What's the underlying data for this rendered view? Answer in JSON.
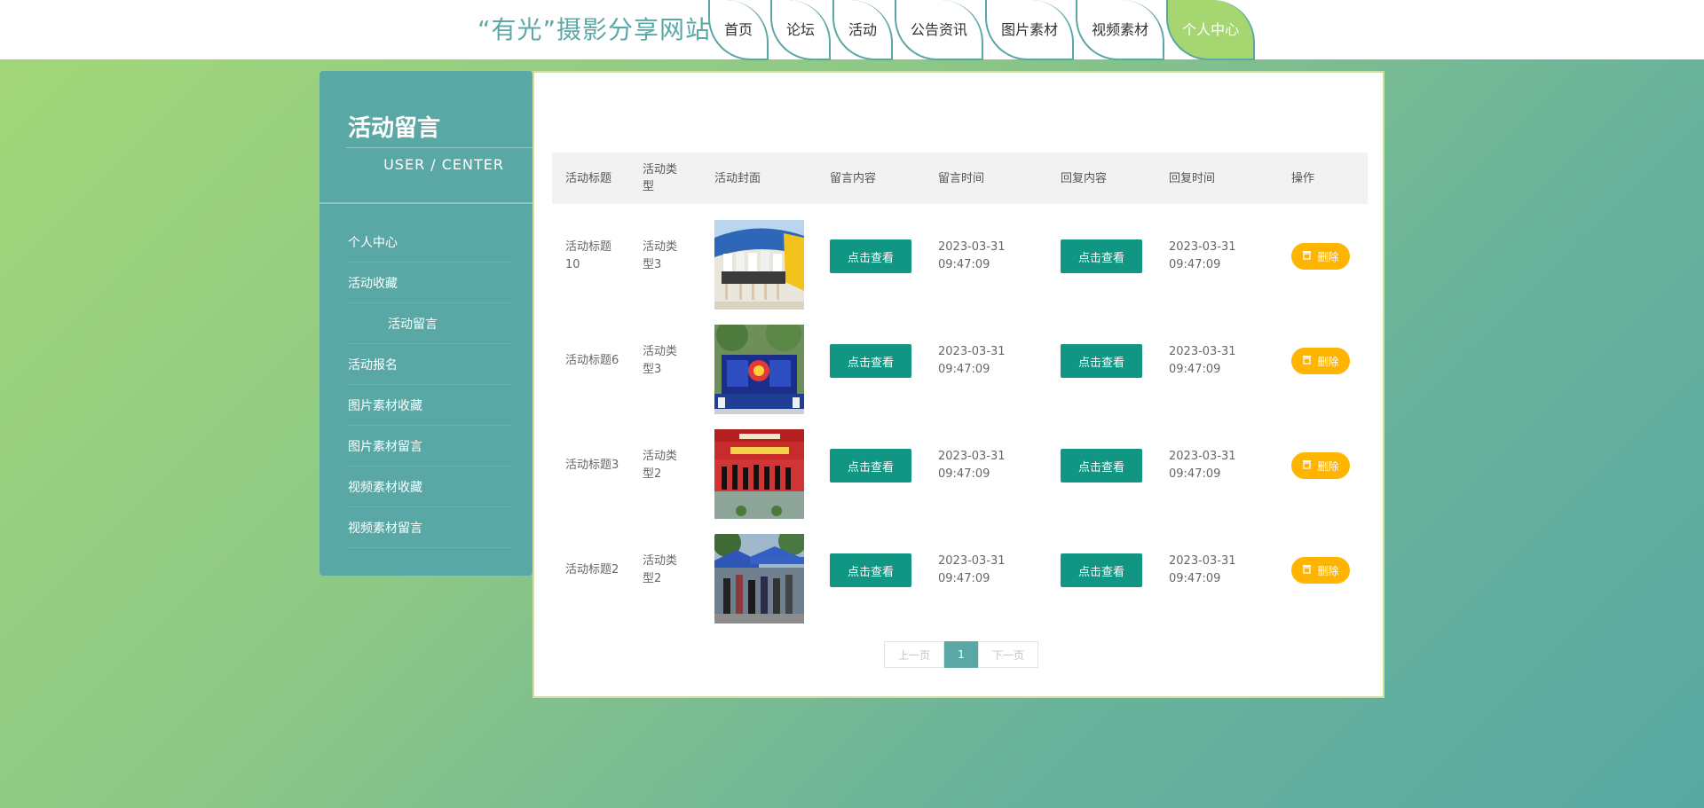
{
  "header": {
    "site_title": "“有光”摄影分享网站",
    "nav": [
      {
        "label": "首页"
      },
      {
        "label": "论坛"
      },
      {
        "label": "活动"
      },
      {
        "label": "公告资讯"
      },
      {
        "label": "图片素材"
      },
      {
        "label": "视频素材"
      },
      {
        "label": "个人中心",
        "active": true
      }
    ]
  },
  "sidebar": {
    "title": "活动留言",
    "subtitle": "USER / CENTER",
    "items": [
      {
        "label": "个人中心"
      },
      {
        "label": "活动收藏"
      },
      {
        "label": "活动留言",
        "active": true
      },
      {
        "label": "活动报名"
      },
      {
        "label": "图片素材收藏"
      },
      {
        "label": "图片素材留言"
      },
      {
        "label": "视频素材收藏"
      },
      {
        "label": "视频素材留言"
      }
    ]
  },
  "table": {
    "headers": [
      "活动标题",
      "活动类型",
      "活动封面",
      "留言内容",
      "留言时间",
      "回复内容",
      "回复时间",
      "操作"
    ],
    "rows": [
      {
        "title": "活动标题10",
        "type": "活动类型3",
        "cover": "students-dancing-photo",
        "msg_btn": "点击查看",
        "msg_time": "2023-03-31 09:47:09",
        "reply_btn": "点击查看",
        "reply_time": "2023-03-31 09:47:09",
        "del_label": "删除"
      },
      {
        "title": "活动标题6",
        "type": "活动类型3",
        "cover": "stage-event-photo",
        "msg_btn": "点击查看",
        "msg_time": "2023-03-31 09:47:09",
        "reply_btn": "点击查看",
        "reply_time": "2023-03-31 09:47:09",
        "del_label": "删除"
      },
      {
        "title": "活动标题3",
        "type": "活动类型2",
        "cover": "performance-banner-photo",
        "msg_btn": "点击查看",
        "msg_time": "2023-03-31 09:47:09",
        "reply_btn": "点击查看",
        "reply_time": "2023-03-31 09:47:09",
        "del_label": "删除"
      },
      {
        "title": "活动标题2",
        "type": "活动类型2",
        "cover": "tent-fair-photo",
        "msg_btn": "点击查看",
        "msg_time": "2023-03-31 09:47:09",
        "reply_btn": "点击查看",
        "reply_time": "2023-03-31 09:47:09",
        "del_label": "删除"
      }
    ]
  },
  "pager": {
    "prev": "上一页",
    "current": "1",
    "next": "下一页"
  },
  "colors": {
    "accent": "#5aa8a6",
    "button": "#119683",
    "delete": "#ffb400",
    "active_nav": "#a5d66f"
  }
}
